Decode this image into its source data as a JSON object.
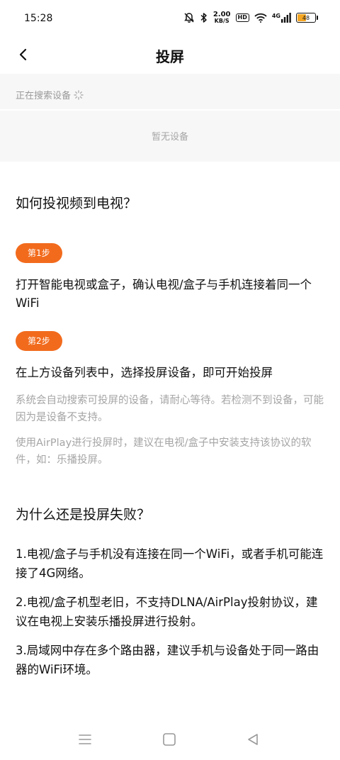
{
  "status_bar": {
    "time": "15:28",
    "net_speed_value": "2.00",
    "net_speed_unit": "KB/S",
    "hd": "HD",
    "signal_type": "4G",
    "battery": "48"
  },
  "header": {
    "title": "投屏"
  },
  "devices": {
    "searching_text": "正在搜索设备",
    "empty_text": "暂无设备"
  },
  "howto": {
    "heading": "如何投视频到电视？",
    "steps": [
      {
        "badge": "第1步",
        "text": "打开智能电视或盒子，确认电视/盒子与手机连接着同一个WiFi"
      },
      {
        "badge": "第2步",
        "text": "在上方设备列表中，选择投屏设备，即可开始投屏"
      }
    ],
    "notes": [
      "系统会自动搜索可投屏的设备，请耐心等待。若检测不到设备，可能因为是设备不支持。",
      "使用AirPlay进行投屏时，建议在电视/盒子中安装支持该协议的软件，如：乐播投屏。"
    ]
  },
  "faq": {
    "heading": "为什么还是投屏失败？",
    "items": [
      "1.电视/盒子与手机没有连接在同一个WiFi，或者手机可能连接了4G网络。",
      "2.电视/盒子机型老旧，不支持DLNA/AirPlay投射协议，建议在电视上安装乐播投屏进行投射。",
      "3.局域网中存在多个路由器，建议手机与设备处于同一路由器的WiFi环境。"
    ]
  },
  "colors": {
    "accent": "#f26b1d",
    "panel": "#f7f7f7",
    "muted": "#a5a5a5"
  },
  "icons": [
    "back-arrow-icon",
    "loading-spinner-icon",
    "mute-bell-icon",
    "bluetooth-icon",
    "wifi-icon",
    "signal-icon",
    "battery-icon",
    "menu-icon",
    "home-icon",
    "back-triangle-icon"
  ]
}
